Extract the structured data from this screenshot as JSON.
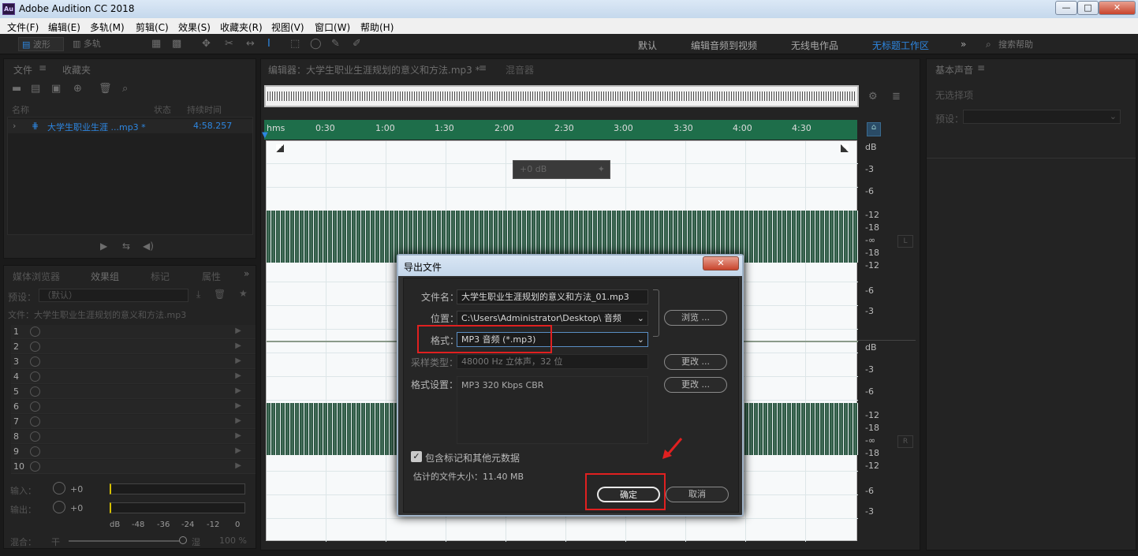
{
  "window": {
    "title": "Adobe Audition CC 2018",
    "app_icon": "Au",
    "min": "—",
    "max": "□",
    "close": "✕"
  },
  "menu": [
    "文件(F)",
    "编辑(E)",
    "多轨(M)",
    "剪辑(C)",
    "效果(S)",
    "收藏夹(R)",
    "视图(V)",
    "窗口(W)",
    "帮助(H)"
  ],
  "toolbar": {
    "waveform": "波形",
    "multitrack": "多轨",
    "workspaces": [
      "默认",
      "编辑音频到视频",
      "无线电作品",
      "无标题工作区"
    ],
    "overflow": "»",
    "search_placeholder": "搜索帮助"
  },
  "files_panel": {
    "tabs": [
      "文件",
      "收藏夹"
    ],
    "col_name": "名称",
    "col_status": "状态",
    "col_duration": "持续时间",
    "file_name": "大学生职业生涯 ...mp3 *",
    "file_duration": "4:58.257"
  },
  "effects_panel": {
    "tabs": [
      "媒体浏览器",
      "效果组",
      "标记",
      "属性"
    ],
    "preset_label": "预设：",
    "preset_value": "（默认）",
    "file_label": "文件：大学生职业生涯规划的意义和方法.mp3",
    "slots": [
      "1",
      "2",
      "3",
      "4",
      "5",
      "6",
      "7",
      "8",
      "9",
      "10"
    ],
    "input_label": "输入：",
    "output_label": "输出：",
    "plus0": "+0",
    "db_scale": [
      "dB",
      "-48",
      "-36",
      "-24",
      "-12",
      "0"
    ],
    "mix_label": "混合：",
    "dry": "干",
    "wet": "湿",
    "mix_value": "100 %"
  },
  "editor": {
    "tab": "编辑器：大学生职业生涯规划的意义和方法.mp3 *",
    "mixer_tab": "混音器",
    "ticks": [
      "hms",
      "0:30",
      "1:00",
      "1:30",
      "2:00",
      "2:30",
      "3:00",
      "3:30",
      "4:00",
      "4:30"
    ],
    "db_top": [
      "dB",
      "-3",
      "-6",
      "-12",
      "-18",
      "-∞",
      "-18",
      "-12",
      "-6",
      "-3"
    ],
    "db_bottom": [
      "dB",
      "-3",
      "-6",
      "-12",
      "-18",
      "-∞",
      "-18",
      "-12",
      "-6",
      "-3"
    ],
    "ch_l": "L",
    "ch_r": "R",
    "hud": "+0 dB"
  },
  "right_panel": {
    "title": "基本声音",
    "no_selection": "无选择项",
    "preset_label": "预设："
  },
  "dialog": {
    "title": "导出文件",
    "close": "✕",
    "filename_label": "文件名：",
    "filename": "大学生职业生涯规划的意义和方法_01.mp3",
    "location_label": "位置：",
    "location": "C:\\Users\\Administrator\\Desktop\\ 音频",
    "browse": "浏览 ...",
    "format_label": "格式：",
    "format": "MP3 音频 (*.mp3)",
    "sample_label": "采样类型：",
    "sample": "48000 Hz 立体声，32 位",
    "change": "更改 ...",
    "settings_label": "格式设置：",
    "settings": "MP3 320 Kbps CBR",
    "include_label": "包含标记和其他元数据",
    "size_label": "估计的文件大小：11.40 MB",
    "ok": "确定",
    "cancel": "取消"
  },
  "colors": {
    "accent": "#2d86e0",
    "wave": "#2f5a45",
    "annot": "#e02020"
  }
}
